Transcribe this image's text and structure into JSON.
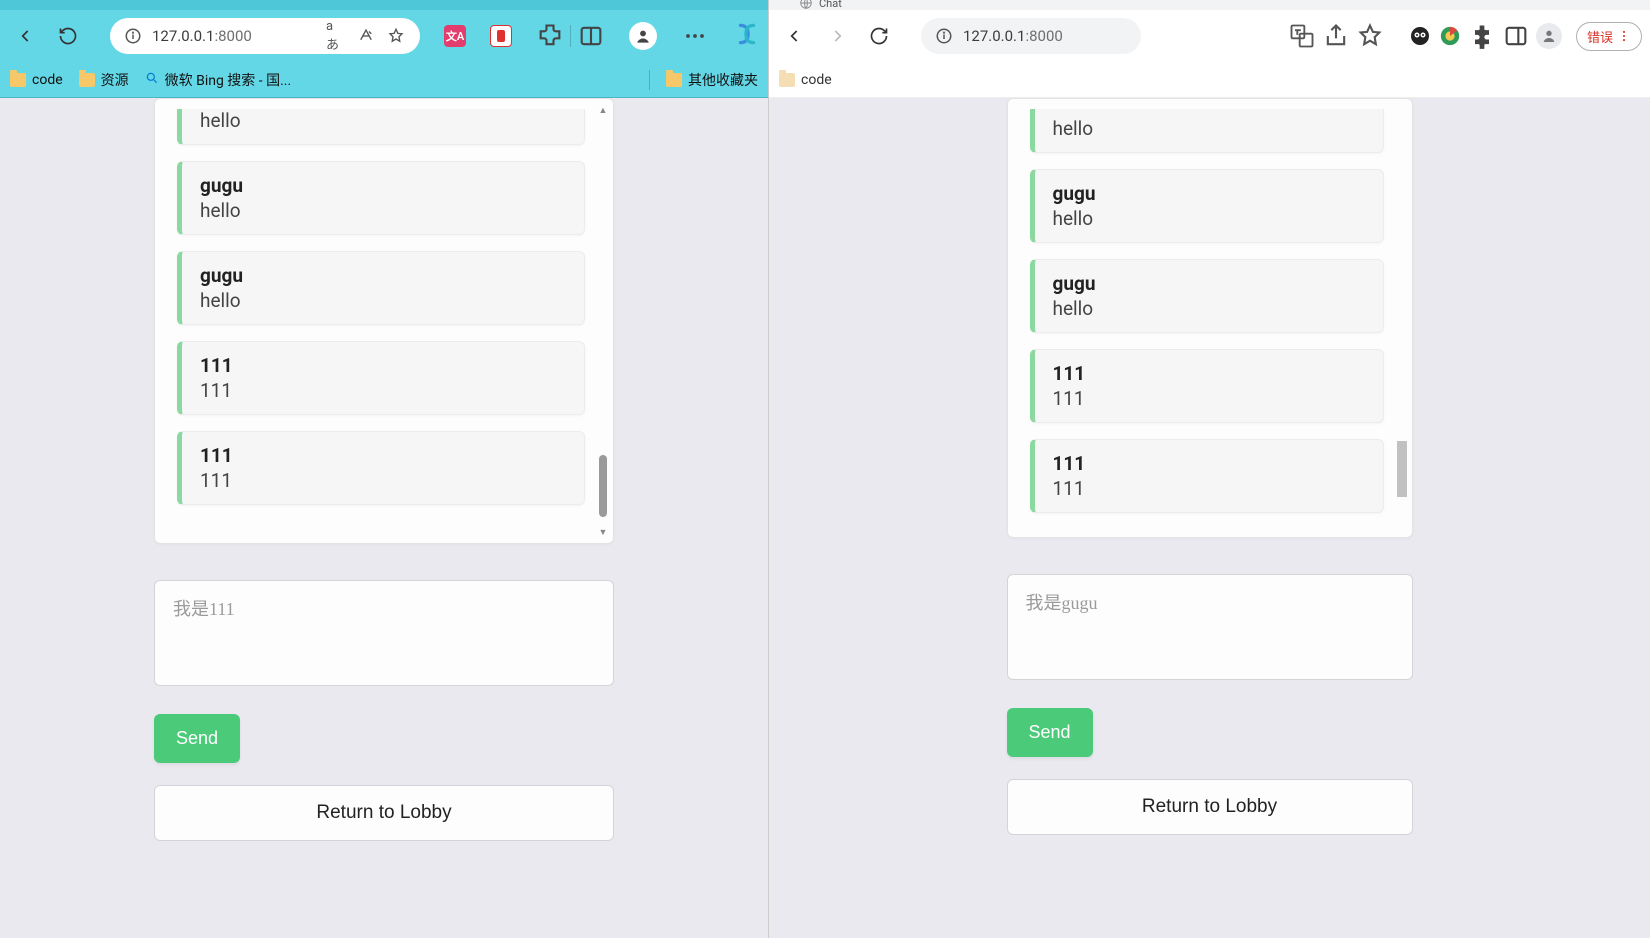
{
  "left": {
    "toolbar": {
      "address_host": "127.0.0.1",
      "address_port": ":8000",
      "lang_indicator": "aあ"
    },
    "bookmarks": {
      "items": [
        {
          "label": "code",
          "kind": "folder"
        },
        {
          "label": "资源",
          "kind": "folder"
        },
        {
          "label": "微软 Bing 搜索 - 国...",
          "kind": "search"
        }
      ],
      "overflow_label": "其他收藏夹"
    },
    "chat": {
      "messages": [
        {
          "sender": "",
          "text": "hello",
          "partial_top": true
        },
        {
          "sender": "gugu",
          "text": "hello"
        },
        {
          "sender": "gugu",
          "text": "hello"
        },
        {
          "sender": "111",
          "text": "111"
        },
        {
          "sender": "111",
          "text": "111"
        }
      ],
      "composer_placeholder": "我是111",
      "send_label": "Send",
      "lobby_label": "Return to Lobby"
    }
  },
  "right": {
    "tab_title_fragment": "Chat",
    "toolbar": {
      "address_host": "127.0.0.1",
      "address_port": ":8000",
      "error_label": "错误"
    },
    "bookmarks": {
      "items": [
        {
          "label": "code",
          "kind": "folder"
        }
      ]
    },
    "chat": {
      "messages": [
        {
          "sender": "",
          "text": "hello",
          "partial_top": true
        },
        {
          "sender": "gugu",
          "text": "hello"
        },
        {
          "sender": "gugu",
          "text": "hello"
        },
        {
          "sender": "111",
          "text": "111"
        },
        {
          "sender": "111",
          "text": "111"
        }
      ],
      "composer_placeholder": "我是gugu",
      "send_label": "Send",
      "lobby_label": "Return to Lobby"
    }
  }
}
